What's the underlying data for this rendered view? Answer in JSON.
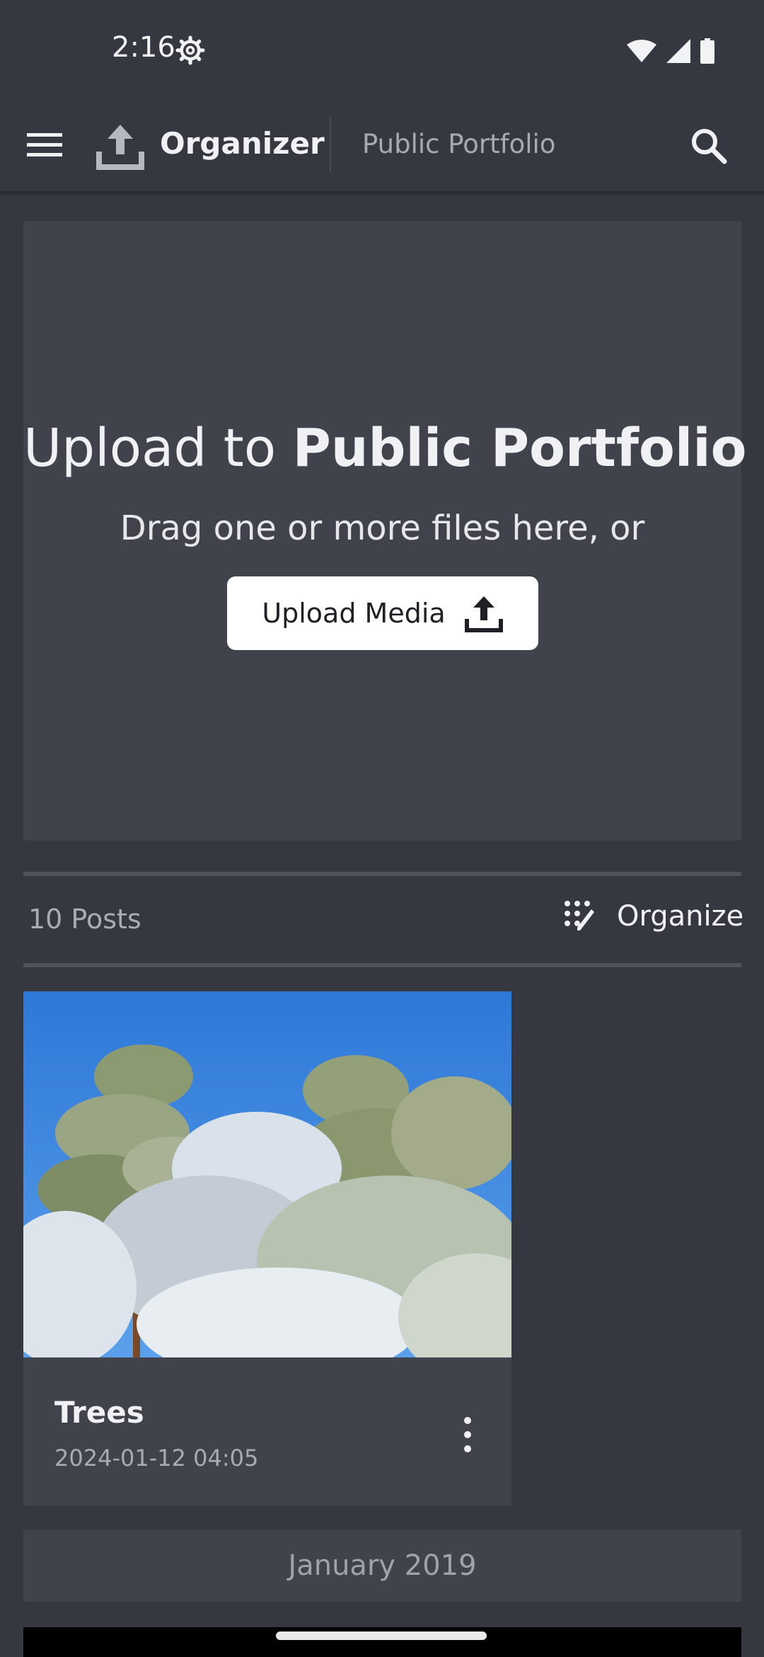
{
  "status_bar": {
    "time": "2:16",
    "icons": [
      "settings-icon",
      "wifi-icon",
      "cellular-icon",
      "battery-icon"
    ]
  },
  "app_bar": {
    "menu_icon": "hamburger-menu-icon",
    "logo_icon": "upload-icon",
    "title": "Organizer",
    "subtitle": "Public Portfolio",
    "search_icon": "search-icon"
  },
  "dropzone": {
    "title_prefix": "Upload to ",
    "title_bold": "Public Portfolio",
    "subtitle": "Drag one or more files here, or",
    "button_label": "Upload Media",
    "button_icon": "upload-icon"
  },
  "posts_bar": {
    "count": "10 Posts",
    "organize_label": "Organize",
    "organize_icon": "magic-wand-grid-icon"
  },
  "posts": [
    {
      "title": "Trees",
      "date": "2024-01-12 04:05",
      "menu_icon": "more-vertical-icon"
    }
  ],
  "sections": [
    {
      "label": "January 2019"
    }
  ],
  "colors": {
    "background": "#353841",
    "card": "#40434c",
    "text": "#f0f1f4",
    "muted": "#a8abb3",
    "button_bg": "#ffffff"
  }
}
